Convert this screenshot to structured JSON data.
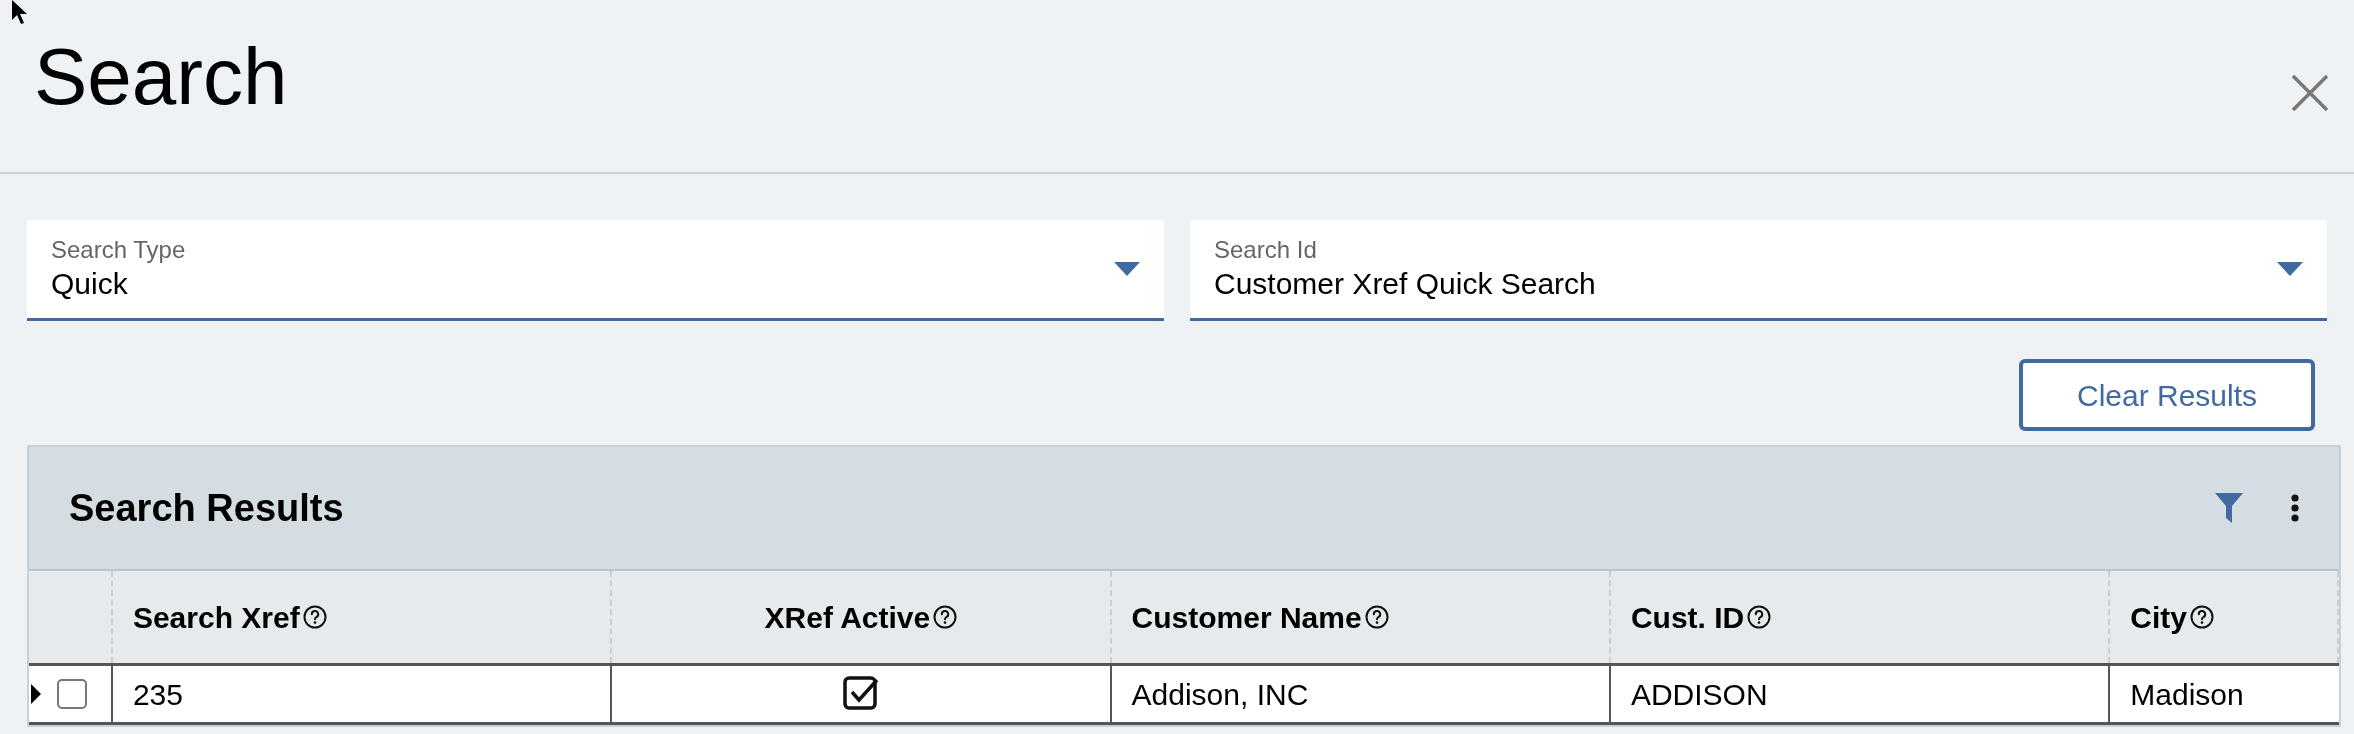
{
  "dialog": {
    "title": "Search"
  },
  "fields": [
    {
      "label": "Search Type",
      "value": "Quick"
    },
    {
      "label": "Search Id",
      "value": "Customer Xref Quick Search"
    }
  ],
  "clear_button": {
    "label": "Clear Results"
  },
  "results": {
    "title": "Search Results",
    "columns": [
      {
        "label": "Search Xref",
        "kind": "text"
      },
      {
        "label": "XRef Active",
        "kind": "check"
      },
      {
        "label": "Customer Name",
        "kind": "text"
      },
      {
        "label": "Cust. ID",
        "kind": "text"
      },
      {
        "label": "City",
        "kind": "text"
      }
    ],
    "rows": [
      {
        "selected": false,
        "cells": [
          {
            "kind": "text",
            "text": "235"
          },
          {
            "kind": "check",
            "checked": true
          },
          {
            "kind": "text",
            "text": "Addison, INC"
          },
          {
            "kind": "text",
            "text": "ADDISON"
          },
          {
            "kind": "text",
            "text": "Madison"
          }
        ]
      }
    ]
  }
}
